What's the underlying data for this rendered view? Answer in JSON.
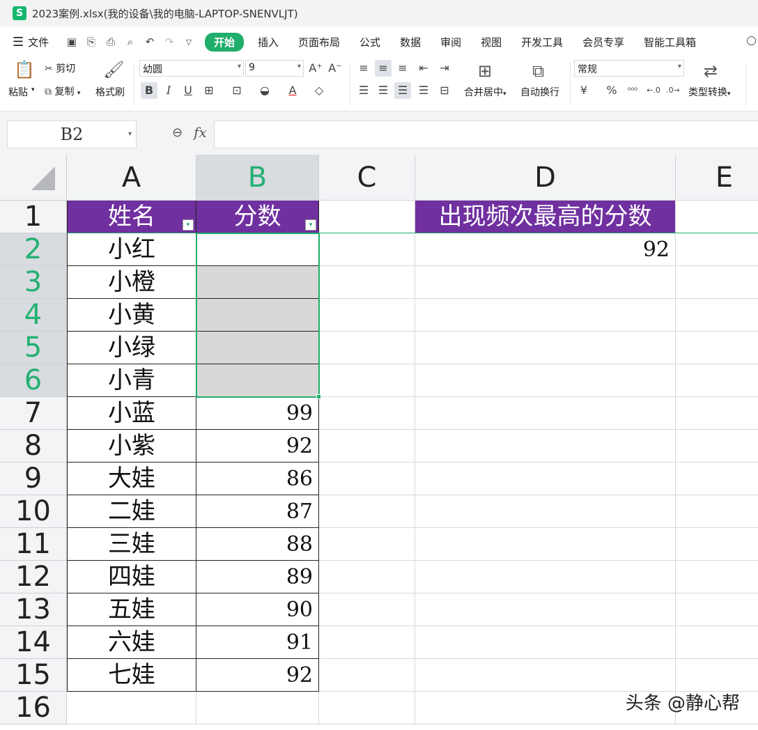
{
  "window": {
    "title": "2023案例.xlsx(我的设备\\我的电脑-LAPTOP-SNENVLJT)",
    "app_logo": "S"
  },
  "menu": {
    "file_label": "文件",
    "tabs": [
      "开始",
      "插入",
      "页面布局",
      "公式",
      "数据",
      "审阅",
      "视图",
      "开发工具",
      "会员专享",
      "智能工具箱"
    ],
    "active_tab": "开始"
  },
  "ribbon": {
    "paste": "粘贴",
    "cut": "剪切",
    "copy": "复制",
    "format_painter": "格式刷",
    "font_name": "幼圆",
    "font_size": "9",
    "merge_center": "合并居中",
    "wrap_text": "自动换行",
    "number_format": "常规",
    "type_convert": "类型转换",
    "percent": "%",
    "currency": "¥"
  },
  "formula_bar": {
    "name_box": "B2",
    "fx": "fx",
    "value": ""
  },
  "grid": {
    "columns": [
      "A",
      "B",
      "C",
      "D",
      "E"
    ],
    "selected_column": "B",
    "rows": [
      "1",
      "2",
      "3",
      "4",
      "5",
      "6",
      "7",
      "8",
      "9",
      "10",
      "11",
      "12",
      "13",
      "14",
      "15",
      "16"
    ],
    "selected_rows": [
      "2",
      "3",
      "4",
      "5",
      "6"
    ],
    "header_name": "姓名",
    "header_score": "分数",
    "names": [
      "小红",
      "小橙",
      "小黄",
      "小绿",
      "小青",
      "小蓝",
      "小紫",
      "大娃",
      "二娃",
      "三娃",
      "四娃",
      "五娃",
      "六娃",
      "七娃"
    ],
    "scores": [
      "",
      "",
      "",
      "",
      "",
      "99",
      "92",
      "86",
      "87",
      "88",
      "89",
      "90",
      "91",
      "92"
    ],
    "d1_label": "出现频次最高的分数",
    "d2_value": "92",
    "header_fill": "#7030a0",
    "selection_color": "#1fae6b"
  },
  "watermark": "头条 @静心帮"
}
